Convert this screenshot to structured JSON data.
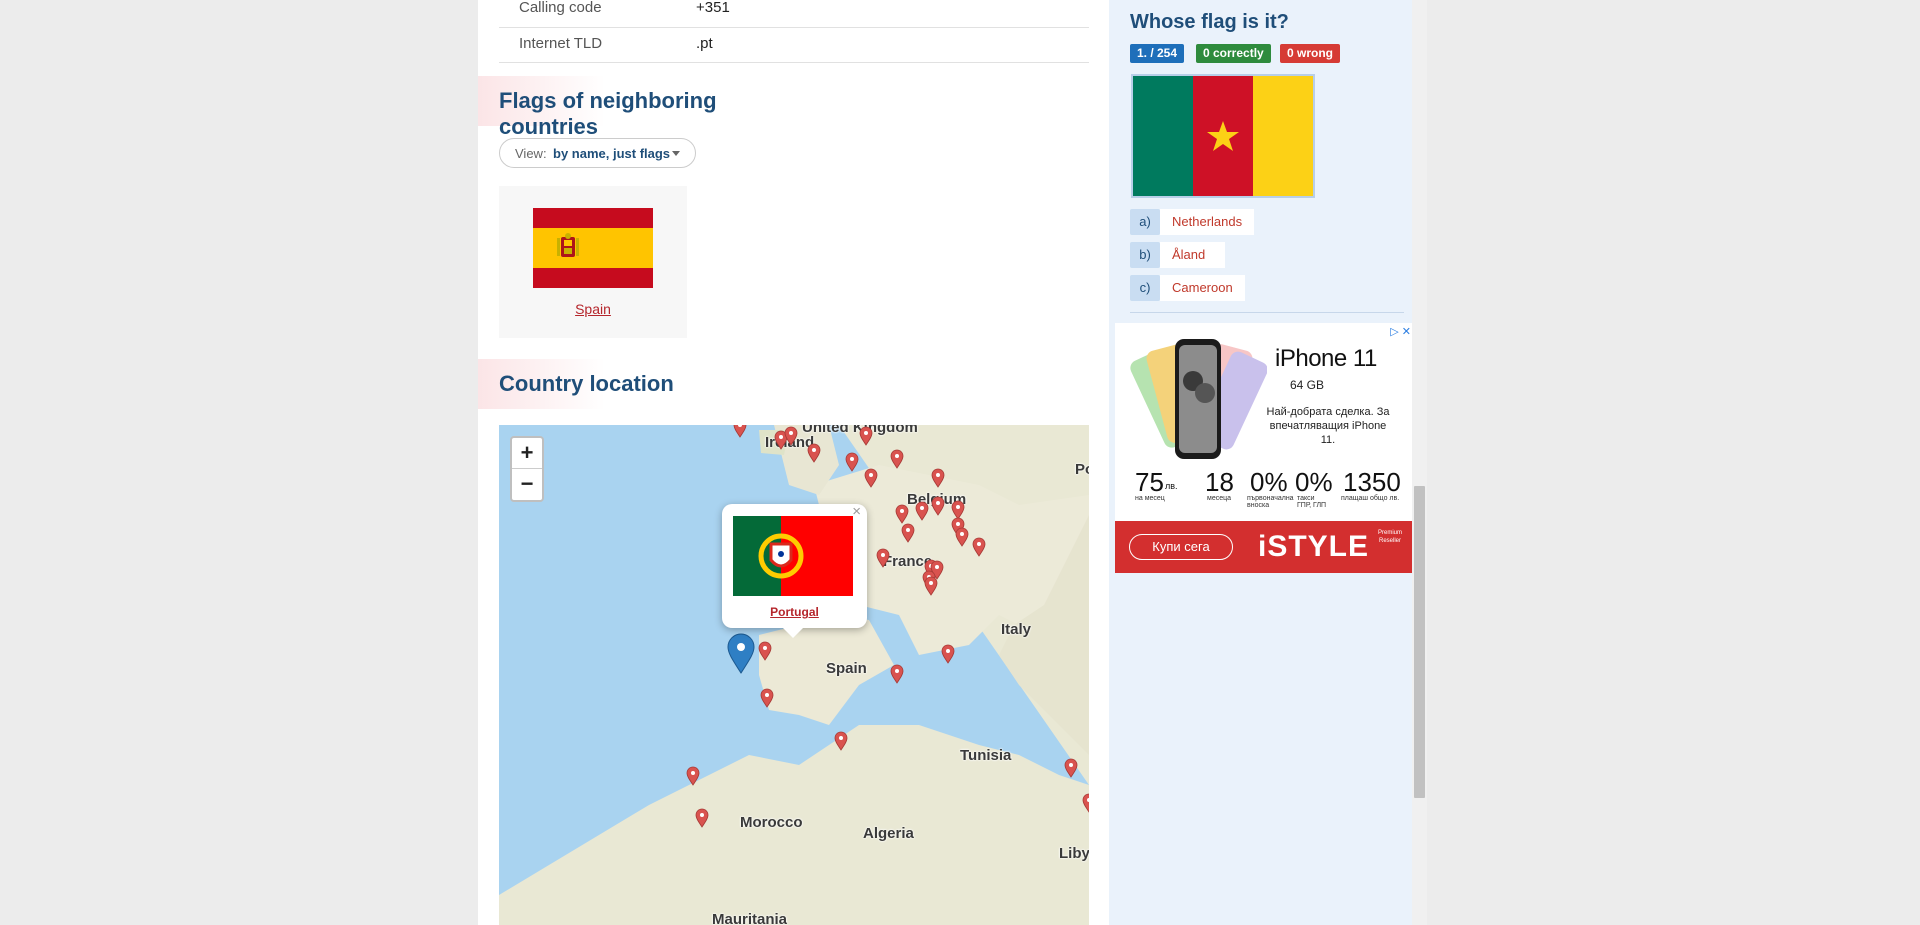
{
  "info": [
    {
      "key": "Calling code",
      "value": "+351"
    },
    {
      "key": "Internet TLD",
      "value": ".pt"
    }
  ],
  "neighbors": {
    "title": "Flags of neighboring countries",
    "view_label": "View:",
    "view_value": "by name, just flags",
    "countries": [
      {
        "name": "Spain"
      }
    ]
  },
  "location": {
    "title": "Country location",
    "zoom_in": "+",
    "zoom_out": "−",
    "popup_close": "×",
    "popup_country": "Portugal",
    "labels": [
      "United Kingdom",
      "Ireland",
      "Belgium",
      "France",
      "Italy",
      "Spain",
      "Tunisia",
      "Morocco",
      "Algeria",
      "Libya",
      "Mauritania",
      "Po"
    ]
  },
  "quiz": {
    "title": "Whose flag is it?",
    "badge_progress": "1. / 254",
    "badge_correct": "0 correctly",
    "badge_wrong": "0 wrong",
    "answers": [
      {
        "letter": "a)",
        "text": "Netherlands"
      },
      {
        "letter": "b)",
        "text": "Åland Islands"
      },
      {
        "letter": "c)",
        "text": "Cameroon"
      }
    ]
  },
  "ad": {
    "headline": "iPhone 11",
    "storage": "64 GB",
    "desc": "Най-добрата сделка. За впечатляващия iPhone 11.",
    "price_monthly": "75",
    "price_monthly_unit": "лв.",
    "price_monthly_note": "на месец",
    "months": "18",
    "months_note": "месеца",
    "down": "0%",
    "down_note": "първоначална вноска",
    "fee": "0%",
    "fee_note": "такси ГПР, ГЛП",
    "total": "1350",
    "total_note": "плащаш общо лв.",
    "cta": "Купи сега",
    "brand": "iSTYLE",
    "reseller": "Premium Reseller"
  },
  "colors": {
    "link": "#b5262c",
    "title": "#1f4e79",
    "badge_blue": "#1e6fba",
    "badge_green": "#2e8b3d",
    "badge_red": "#d63b35",
    "pin_red": "#d9534f",
    "pin_blue": "#2f7fc4"
  }
}
